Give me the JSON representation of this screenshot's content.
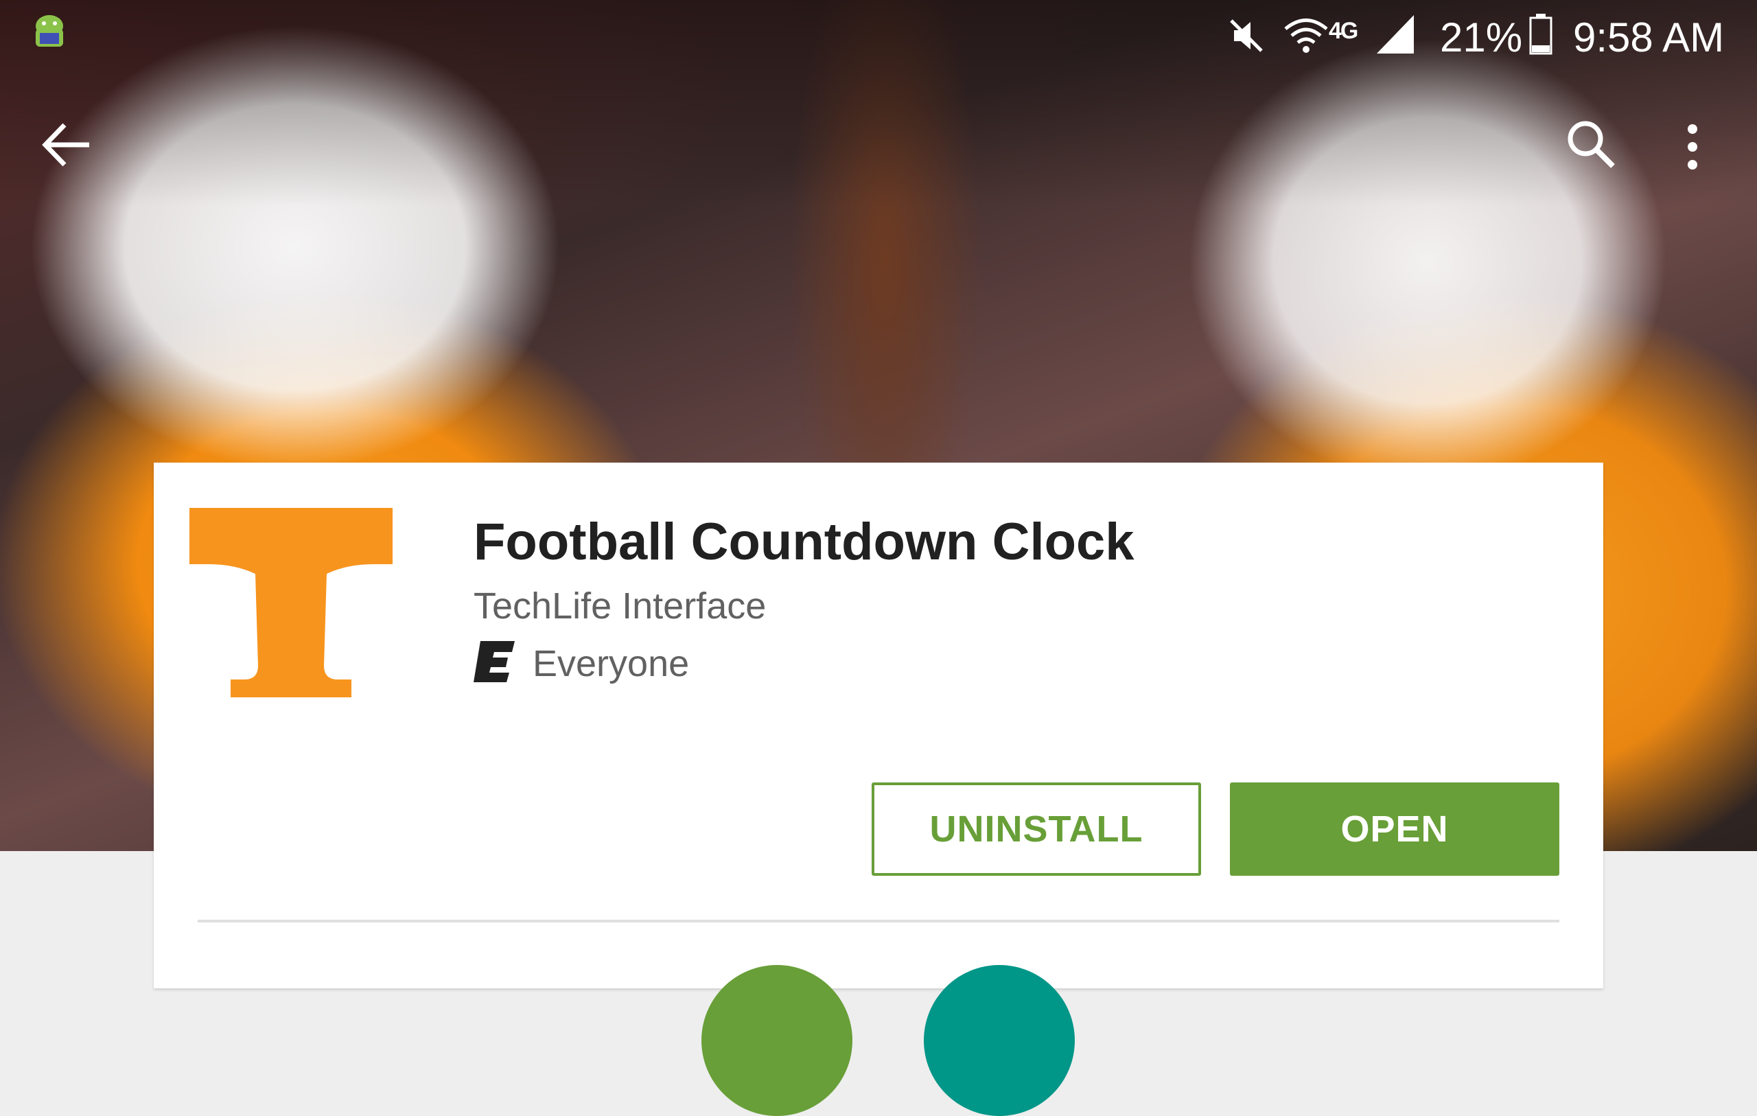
{
  "status_bar": {
    "network": "4G",
    "battery_percent": "21%",
    "time": "9:58 AM"
  },
  "toolbar": {
    "icons": [
      "back-arrow-icon",
      "search-icon",
      "more-vert-icon"
    ]
  },
  "app": {
    "title": "Football Countdown Clock",
    "developer": "TechLife Interface",
    "content_rating": "Everyone",
    "logo_color": "#F7941D"
  },
  "actions": {
    "uninstall_label": "UNINSTALL",
    "open_label": "OPEN",
    "accent_color": "#689F38"
  }
}
